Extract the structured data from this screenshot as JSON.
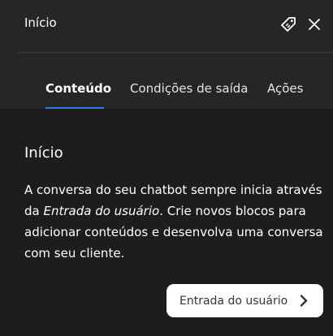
{
  "header": {
    "title": "Início",
    "tag_icon": "tag-icon",
    "close_icon": "close-icon"
  },
  "tabs": [
    {
      "label": "Conteúdo",
      "active": true
    },
    {
      "label": "Condições de saída",
      "active": false
    },
    {
      "label": "Ações",
      "active": false
    }
  ],
  "content": {
    "title": "Início",
    "description_before": "A conversa do seu chatbot sempre inicia através da ",
    "description_emphasis": "Entrada do usuário",
    "description_after": ". Crie novos blocos para adicionar conteúdos e desenvolva uma conversa com seu cliente."
  },
  "entry_button": {
    "label": "Entrada do usuário",
    "icon": "chevron-right-icon"
  },
  "colors": {
    "background": "#1d1d1d",
    "header": "#262626",
    "accent": "#2f7de1",
    "button_bg": "#ffffff"
  }
}
